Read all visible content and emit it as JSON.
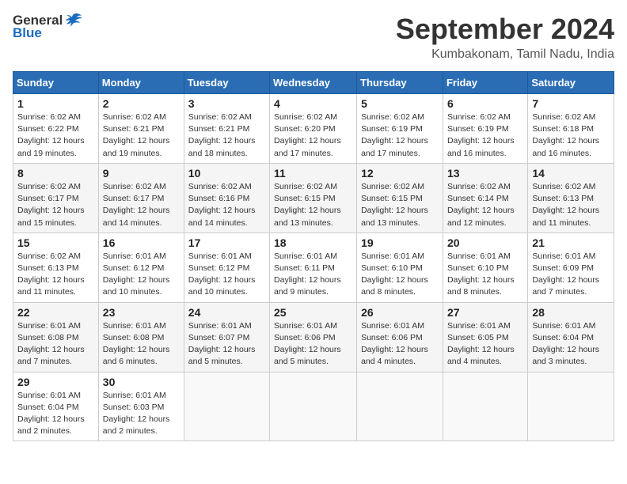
{
  "header": {
    "logo_general": "General",
    "logo_blue": "Blue",
    "month": "September 2024",
    "location": "Kumbakonam, Tamil Nadu, India"
  },
  "columns": [
    "Sunday",
    "Monday",
    "Tuesday",
    "Wednesday",
    "Thursday",
    "Friday",
    "Saturday"
  ],
  "weeks": [
    [
      {
        "day": "1",
        "sunrise": "6:02 AM",
        "sunset": "6:22 PM",
        "daylight": "12 hours and 19 minutes."
      },
      {
        "day": "2",
        "sunrise": "6:02 AM",
        "sunset": "6:21 PM",
        "daylight": "12 hours and 19 minutes."
      },
      {
        "day": "3",
        "sunrise": "6:02 AM",
        "sunset": "6:21 PM",
        "daylight": "12 hours and 18 minutes."
      },
      {
        "day": "4",
        "sunrise": "6:02 AM",
        "sunset": "6:20 PM",
        "daylight": "12 hours and 17 minutes."
      },
      {
        "day": "5",
        "sunrise": "6:02 AM",
        "sunset": "6:19 PM",
        "daylight": "12 hours and 17 minutes."
      },
      {
        "day": "6",
        "sunrise": "6:02 AM",
        "sunset": "6:19 PM",
        "daylight": "12 hours and 16 minutes."
      },
      {
        "day": "7",
        "sunrise": "6:02 AM",
        "sunset": "6:18 PM",
        "daylight": "12 hours and 16 minutes."
      }
    ],
    [
      {
        "day": "8",
        "sunrise": "6:02 AM",
        "sunset": "6:17 PM",
        "daylight": "12 hours and 15 minutes."
      },
      {
        "day": "9",
        "sunrise": "6:02 AM",
        "sunset": "6:17 PM",
        "daylight": "12 hours and 14 minutes."
      },
      {
        "day": "10",
        "sunrise": "6:02 AM",
        "sunset": "6:16 PM",
        "daylight": "12 hours and 14 minutes."
      },
      {
        "day": "11",
        "sunrise": "6:02 AM",
        "sunset": "6:15 PM",
        "daylight": "12 hours and 13 minutes."
      },
      {
        "day": "12",
        "sunrise": "6:02 AM",
        "sunset": "6:15 PM",
        "daylight": "12 hours and 13 minutes."
      },
      {
        "day": "13",
        "sunrise": "6:02 AM",
        "sunset": "6:14 PM",
        "daylight": "12 hours and 12 minutes."
      },
      {
        "day": "14",
        "sunrise": "6:02 AM",
        "sunset": "6:13 PM",
        "daylight": "12 hours and 11 minutes."
      }
    ],
    [
      {
        "day": "15",
        "sunrise": "6:02 AM",
        "sunset": "6:13 PM",
        "daylight": "12 hours and 11 minutes."
      },
      {
        "day": "16",
        "sunrise": "6:01 AM",
        "sunset": "6:12 PM",
        "daylight": "12 hours and 10 minutes."
      },
      {
        "day": "17",
        "sunrise": "6:01 AM",
        "sunset": "6:12 PM",
        "daylight": "12 hours and 10 minutes."
      },
      {
        "day": "18",
        "sunrise": "6:01 AM",
        "sunset": "6:11 PM",
        "daylight": "12 hours and 9 minutes."
      },
      {
        "day": "19",
        "sunrise": "6:01 AM",
        "sunset": "6:10 PM",
        "daylight": "12 hours and 8 minutes."
      },
      {
        "day": "20",
        "sunrise": "6:01 AM",
        "sunset": "6:10 PM",
        "daylight": "12 hours and 8 minutes."
      },
      {
        "day": "21",
        "sunrise": "6:01 AM",
        "sunset": "6:09 PM",
        "daylight": "12 hours and 7 minutes."
      }
    ],
    [
      {
        "day": "22",
        "sunrise": "6:01 AM",
        "sunset": "6:08 PM",
        "daylight": "12 hours and 7 minutes."
      },
      {
        "day": "23",
        "sunrise": "6:01 AM",
        "sunset": "6:08 PM",
        "daylight": "12 hours and 6 minutes."
      },
      {
        "day": "24",
        "sunrise": "6:01 AM",
        "sunset": "6:07 PM",
        "daylight": "12 hours and 5 minutes."
      },
      {
        "day": "25",
        "sunrise": "6:01 AM",
        "sunset": "6:06 PM",
        "daylight": "12 hours and 5 minutes."
      },
      {
        "day": "26",
        "sunrise": "6:01 AM",
        "sunset": "6:06 PM",
        "daylight": "12 hours and 4 minutes."
      },
      {
        "day": "27",
        "sunrise": "6:01 AM",
        "sunset": "6:05 PM",
        "daylight": "12 hours and 4 minutes."
      },
      {
        "day": "28",
        "sunrise": "6:01 AM",
        "sunset": "6:04 PM",
        "daylight": "12 hours and 3 minutes."
      }
    ],
    [
      {
        "day": "29",
        "sunrise": "6:01 AM",
        "sunset": "6:04 PM",
        "daylight": "12 hours and 2 minutes."
      },
      {
        "day": "30",
        "sunrise": "6:01 AM",
        "sunset": "6:03 PM",
        "daylight": "12 hours and 2 minutes."
      },
      null,
      null,
      null,
      null,
      null
    ]
  ]
}
